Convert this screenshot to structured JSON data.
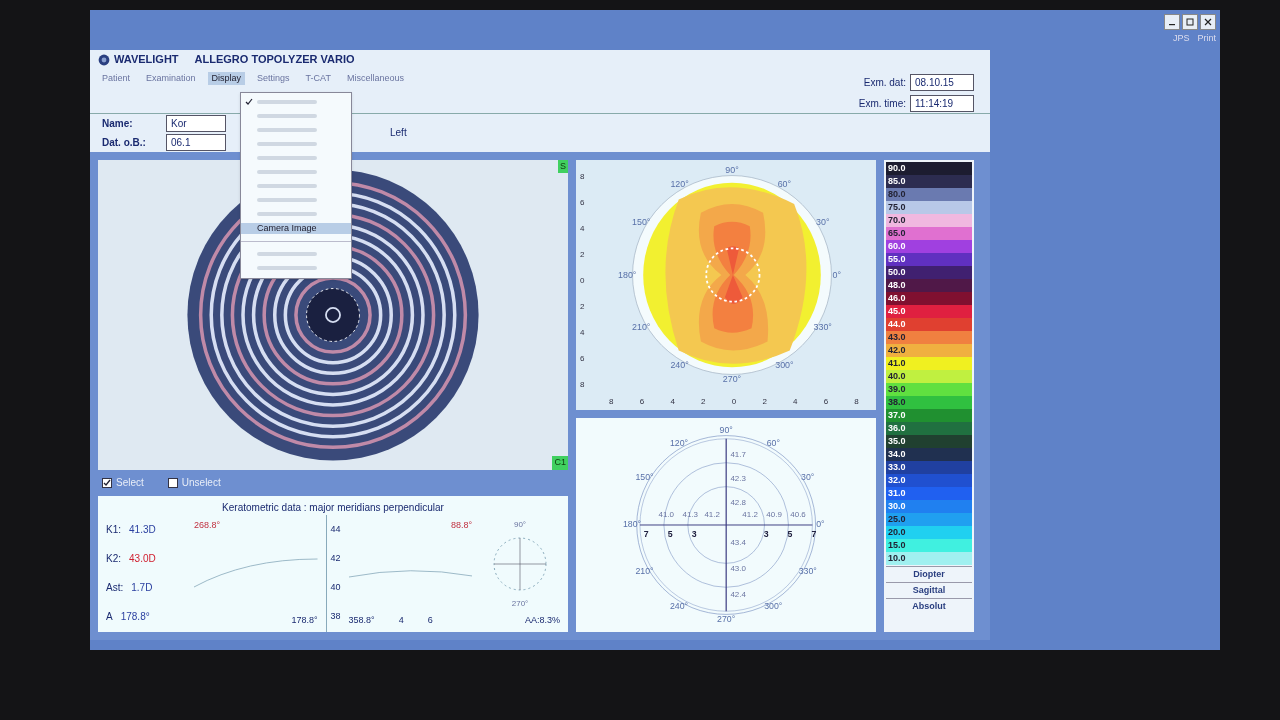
{
  "window": {
    "brand": "WAVELIGHT",
    "title": "ALLEGRO TOPOLYZER VARIO",
    "buttons": [
      "JPS",
      "Print"
    ]
  },
  "menu": [
    {
      "label": "Patient",
      "selected": false
    },
    {
      "label": "Examination",
      "selected": false
    },
    {
      "label": "Display",
      "selected": true
    },
    {
      "label": "Settings",
      "selected": false
    },
    {
      "label": "T-CAT",
      "selected": false
    },
    {
      "label": "Miscellaneous",
      "selected": false
    }
  ],
  "dropdown": [
    {
      "kind": "illegible",
      "checked": true,
      "selected": false
    },
    {
      "kind": "illegible",
      "checked": false,
      "selected": false
    },
    {
      "kind": "illegible",
      "checked": false,
      "selected": false
    },
    {
      "kind": "illegible",
      "checked": false,
      "selected": false
    },
    {
      "kind": "illegible",
      "checked": false,
      "selected": false
    },
    {
      "kind": "illegible",
      "checked": false,
      "selected": false
    },
    {
      "kind": "illegible",
      "checked": false,
      "selected": false
    },
    {
      "kind": "illegible",
      "checked": false,
      "selected": false
    },
    {
      "kind": "illegible",
      "checked": false,
      "selected": false
    },
    {
      "kind": "entry",
      "label": "Camera Image",
      "selected": true
    },
    {
      "kind": "separator"
    },
    {
      "kind": "illegible",
      "checked": false,
      "selected": false
    },
    {
      "kind": "illegible",
      "checked": false,
      "selected": false
    }
  ],
  "exam": [
    {
      "label": "Exm. dat:",
      "value": "08.10.15"
    },
    {
      "label": "Exm. time:",
      "value": "11:14:19"
    }
  ],
  "patient": [
    {
      "label": "Name:",
      "value": "Kor"
    },
    {
      "label": "Dat. o.B.:",
      "value": "06.1"
    }
  ],
  "eye_side": "Left",
  "image": {
    "corner_top": "S",
    "corner_bottom": "C1"
  },
  "selection": [
    {
      "label": "Select",
      "checked": true
    },
    {
      "label": "Unselect",
      "checked": false
    }
  ],
  "keratometric": {
    "title": "Keratometric data : major meridians perpendicular",
    "values": [
      {
        "label": "K1:",
        "value": "41.3D",
        "color": "#2a3fa0"
      },
      {
        "label": "K2:",
        "value": "43.0D",
        "color": "#d02030"
      },
      {
        "label": "Ast:",
        "value": "1.7D",
        "color": "#2a3fa0"
      },
      {
        "label": "A",
        "value": "178.8°",
        "color": "#2a3fa0"
      }
    ],
    "angles": [
      "268.8°",
      "88.8°",
      "358.8°",
      "178.8°"
    ],
    "yticks": [
      "44",
      "42",
      "40",
      "38"
    ],
    "xticks": [
      "4",
      "6"
    ],
    "mini_angles": [
      "90°",
      "270°"
    ],
    "aa": "AA:8.3%"
  },
  "topography": {
    "angles": [
      "90°",
      "60°",
      "30°",
      "0°",
      "330°",
      "300°",
      "270°",
      "240°",
      "210°",
      "180°",
      "150°",
      "120°"
    ],
    "yticks": [
      "8",
      "6",
      "4",
      "2",
      "0",
      "2",
      "4",
      "6",
      "8"
    ],
    "xticks": [
      "8",
      "6",
      "4",
      "2",
      "0",
      "2",
      "4",
      "6",
      "8"
    ]
  },
  "polar": {
    "angles": [
      "90°",
      "60°",
      "30°",
      "0°",
      "330°",
      "300°",
      "270°",
      "240°",
      "210°",
      "180°",
      "150°",
      "120°"
    ],
    "values": [
      "41.7",
      "42.3",
      "42.8",
      "41.0",
      "41.3",
      "41.2",
      "41.2",
      "40.9",
      "40.6",
      "43.4",
      "43.0",
      "42.4"
    ],
    "rings": [
      "7",
      "5",
      "3",
      "3",
      "5",
      "7"
    ]
  },
  "scale": {
    "items": [
      {
        "label": "90.0",
        "color": "#1c1c30"
      },
      {
        "label": "85.0",
        "color": "#2c2c50"
      },
      {
        "label": "80.0",
        "color": "#6a7ab0"
      },
      {
        "label": "75.0",
        "color": "#b8c8e8"
      },
      {
        "label": "70.0",
        "color": "#f0b8e0"
      },
      {
        "label": "65.0",
        "color": "#e070d0"
      },
      {
        "label": "60.0",
        "color": "#a040e0"
      },
      {
        "label": "55.0",
        "color": "#6030c0"
      },
      {
        "label": "50.0",
        "color": "#402070"
      },
      {
        "label": "48.0",
        "color": "#501848"
      },
      {
        "label": "46.0",
        "color": "#801030"
      },
      {
        "label": "45.0",
        "color": "#e02040"
      },
      {
        "label": "44.0",
        "color": "#e04030"
      },
      {
        "label": "43.0",
        "color": "#f08040"
      },
      {
        "label": "42.0",
        "color": "#f0b040"
      },
      {
        "label": "41.0",
        "color": "#f0f020"
      },
      {
        "label": "40.0",
        "color": "#c0f040"
      },
      {
        "label": "39.0",
        "color": "#60e040"
      },
      {
        "label": "38.0",
        "color": "#30c040"
      },
      {
        "label": "37.0",
        "color": "#209030"
      },
      {
        "label": "36.0",
        "color": "#207040"
      },
      {
        "label": "35.0",
        "color": "#204030"
      },
      {
        "label": "34.0",
        "color": "#203050"
      },
      {
        "label": "33.0",
        "color": "#2040a0"
      },
      {
        "label": "32.0",
        "color": "#2050d0"
      },
      {
        "label": "31.0",
        "color": "#2060f0"
      },
      {
        "label": "30.0",
        "color": "#2080f0"
      },
      {
        "label": "25.0",
        "color": "#20a0f0"
      },
      {
        "label": "20.0",
        "color": "#20d0f0"
      },
      {
        "label": "15.0",
        "color": "#40f0e0"
      },
      {
        "label": "10.0",
        "color": "#a0f0f0"
      }
    ],
    "buttons": [
      "Diopter",
      "Sagittal",
      "Absolut"
    ]
  }
}
